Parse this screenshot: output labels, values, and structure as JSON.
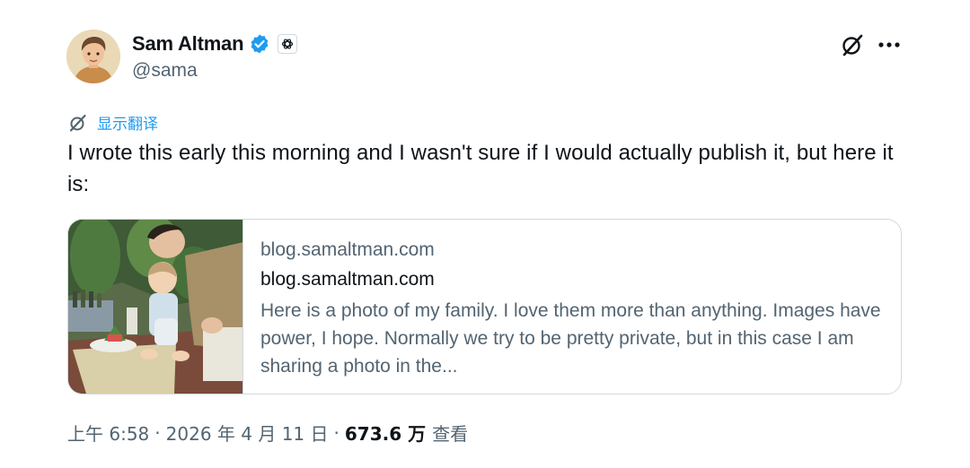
{
  "author": {
    "display_name": "Sam Altman",
    "handle": "@sama"
  },
  "icons": {
    "verified": "verified-badge-icon",
    "affiliate": "openai-logo-icon",
    "grok": "grok-icon",
    "more": "more-icon",
    "translate": "translate-icon"
  },
  "colors": {
    "accent": "#1d9bf0",
    "text": "#0f1419",
    "secondary": "#536471",
    "border": "#cfd9de"
  },
  "translate_label": "显示翻译",
  "tweet_text": "I wrote this early this morning and I wasn't sure if I would actually publish it, but here it is:",
  "card": {
    "domain": "blog.samaltman.com",
    "title": "blog.samaltman.com",
    "description": "Here is a photo of my family. I love them more than anything. Images have power, I hope. Normally we try to be pretty private, but in this case I am sharing a photo in the..."
  },
  "meta": {
    "time": "上午 6:58",
    "separator": "·",
    "date": "2026 年 4 月 11 日",
    "views_count": "673.6 万",
    "views_label": "查看"
  }
}
